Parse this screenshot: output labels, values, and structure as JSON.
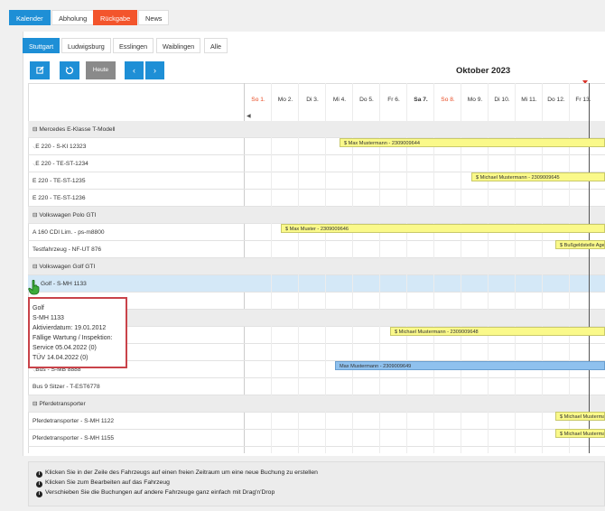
{
  "top_tabs": [
    "Kalender",
    "Abholung",
    "Rückgabe",
    "News"
  ],
  "location_tabs": [
    "Stuttgart",
    "Ludwigsburg",
    "Esslingen",
    "Waiblingen",
    "Alle"
  ],
  "toolbar": {
    "edit_icon": "edit-icon",
    "refresh_icon": "refresh-icon",
    "today_label": "Heute",
    "prev_label": "‹",
    "next_label": "›"
  },
  "calendar": {
    "month": "Oktober 2023",
    "days": [
      "So 1.",
      "Mo 2.",
      "Di 3.",
      "Mi 4.",
      "Do 5.",
      "Fr 6.",
      "Sa 7.",
      "So 8.",
      "Mo 9.",
      "Di 10.",
      "Mi 11.",
      "Do 12.",
      "Fr 13."
    ],
    "collapse_arrow": "◀"
  },
  "groups": [
    {
      "name": "Mercedes E-Klasse T-Modell",
      "vehicles": [
        "E 220 - S-KI 12323",
        "E 220 - TE-ST-1234",
        "E 220 - TE-ST-1235",
        "E 220 - TE-ST-1236"
      ]
    },
    {
      "name": "Volkswagen Polo GTI",
      "vehicles": [
        "A 160 CDI Lim. - ps-m8800",
        "Testfahrzeug - NF-UT 876"
      ]
    },
    {
      "name": "Volkswagen Golf GTI",
      "vehicles": [
        "Golf - S-MH 1133"
      ]
    },
    {
      "name": "",
      "vehicles": [
        "Bus - S-MB 8888",
        "Bus 9 Sitzer - T-EST6778"
      ]
    },
    {
      "name": "Pferdetransporter",
      "vehicles": [
        "Pferdetransporter - S-MH 1122",
        "Pferdetransporter - S-MH 1155"
      ]
    }
  ],
  "bookings": [
    "$ Max Mustermann - 2309009644",
    "$ Michael Mustermann - 2309009645",
    "$ Max Muster - 2309009646",
    "$ Bußgeldstelle Agentur",
    "$ Michael Mustermann - 2309009648",
    "Max Mustermann - 2309009649",
    "$ Michael Mustermann",
    "$ Michael Mustermann"
  ],
  "tooltip": {
    "lines": [
      "Golf",
      "S-MH 1133",
      "Aktivierdatum: 19.01.2012",
      "Fällige Wartung / Inspektion:",
      "Service 05.04.2022 (0)",
      "TÜV 14.04.2022 (0)"
    ]
  },
  "hints": [
    "Klicken Sie in der Zeile des Fahrzeugs auf einen freien Zeitraum um eine neue Buchung zu erstellen",
    "Klicken Sie zum Bearbeiten auf das Fahrzeug",
    "Verschieben Sie die Buchungen auf andere Fahrzeuge ganz einfach mit Drag'n'Drop"
  ],
  "colors": {
    "accent": "#1e8fd6",
    "active_tab_red": "#f3552c",
    "booking_yellow": "#faf98a",
    "booking_blue": "#8fc1ee",
    "today_marker": "#d9342b",
    "tooltip_border": "#c9434a"
  }
}
